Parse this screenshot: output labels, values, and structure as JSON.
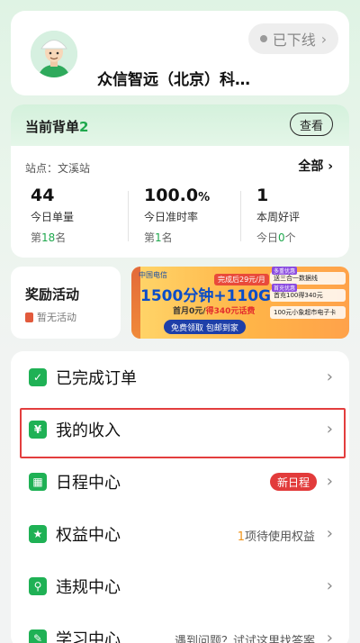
{
  "profile": {
    "company_name": "众信智远（北京）科…",
    "status_text": "已下线",
    "status_chevron": "›"
  },
  "orders": {
    "title": "当前背单",
    "count": "2",
    "view_label": "查看",
    "station_label": "站点：",
    "station_name": "文溪站",
    "all_label": "全部",
    "all_chevron": "›",
    "stats": [
      {
        "value": "44",
        "unit": "",
        "label": "今日单量",
        "rank_prefix": "第",
        "rank_value": "18",
        "rank_suffix": "名"
      },
      {
        "value": "100.0",
        "unit": "%",
        "label": "今日准时率",
        "rank_prefix": "第",
        "rank_value": "1",
        "rank_suffix": "名"
      },
      {
        "value": "1",
        "unit": "",
        "label": "本周好评",
        "rank_prefix": "今日",
        "rank_value": "0",
        "rank_suffix": "个"
      }
    ]
  },
  "rewards": {
    "title": "奖励活动",
    "subtitle": "暂无活动"
  },
  "banner": {
    "logo_text": "中国电信",
    "headline": "1500分钟+110G",
    "price_tag": "完成后29元/月",
    "line2_prefix": "首月0元/",
    "line2_highlight": "得340元话费",
    "cta": "免费领取 包邮到家",
    "side_rows": [
      {
        "badge": "多重优惠",
        "text": "送三合一数据线"
      },
      {
        "badge": "首充优惠",
        "text": "首充100得340元"
      },
      {
        "badge": "",
        "text": "100元小象超市电子卡"
      }
    ]
  },
  "menu": {
    "items": [
      {
        "label": "已完成订单",
        "icon": "check-square-icon",
        "glyph": "✓"
      },
      {
        "label": "我的收入",
        "icon": "income-wallet-icon",
        "glyph": "¥"
      },
      {
        "label": "日程中心",
        "icon": "calendar-icon",
        "glyph": "▦",
        "badge": "新日程"
      },
      {
        "label": "权益中心",
        "icon": "star-badge-icon",
        "glyph": "★",
        "extra_highlight": "1",
        "extra_text": "项待使用权益"
      },
      {
        "label": "违规中心",
        "icon": "search-doc-icon",
        "glyph": "⚲"
      },
      {
        "label": "学习中心",
        "icon": "book-icon",
        "glyph": "✎",
        "extra_text": "遇到问题？试试这里找答案"
      }
    ],
    "chevron": "›"
  },
  "colors": {
    "brand_green": "#1fb155",
    "rank_green": "#1fa84d",
    "alert_red": "#e23b3b",
    "highlight_orange": "#f0941b"
  }
}
